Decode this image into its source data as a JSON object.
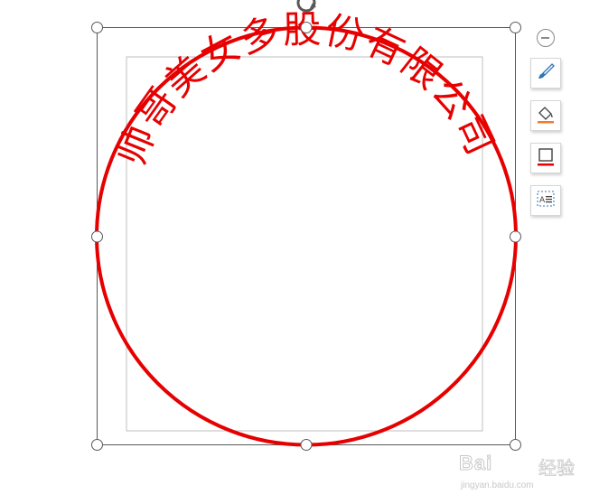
{
  "seal": {
    "text": "帅哥美女多股份有限公司",
    "color": "#e60000"
  },
  "toolbar": {
    "items": [
      {
        "icon": "minus-circle-icon",
        "action": "collapse-toolbar"
      },
      {
        "icon": "brush-style-icon",
        "action": "shape-style"
      },
      {
        "icon": "fill-bucket-icon",
        "action": "shape-fill",
        "accent": "#f07c2c"
      },
      {
        "icon": "outline-icon",
        "action": "shape-outline",
        "accent": "#e60000"
      },
      {
        "icon": "text-wrap-icon",
        "action": "layout-options"
      }
    ]
  },
  "watermark": {
    "brand": "Bai",
    "brand_cn": "经验",
    "url": "jingyan.baidu.com"
  },
  "colors": {
    "selection_frame": "#595959",
    "inner_frame": "#bfbfbf",
    "handle_border": "#595959",
    "accent_blue": "#2e75b6"
  }
}
